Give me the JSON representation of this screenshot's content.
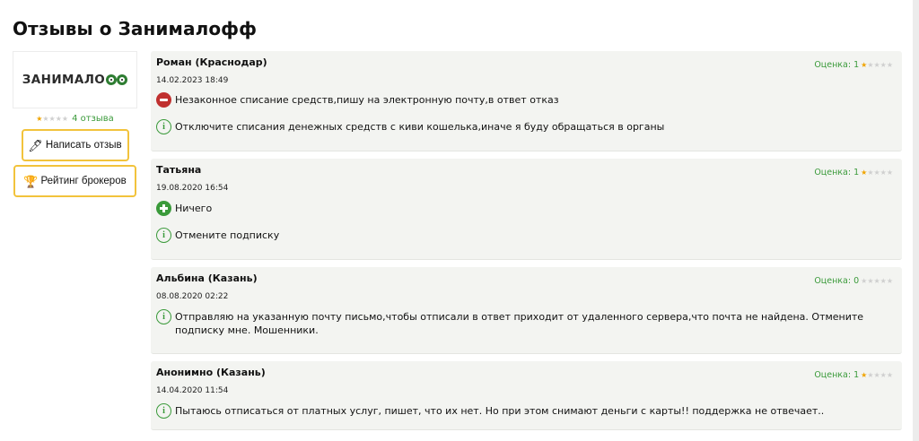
{
  "page": {
    "title": "Отзывы о Занималофф"
  },
  "sidebar": {
    "logo_text": "ЗАНИМАЛО",
    "rating_count": "4 отзыва",
    "rating_stars": 1,
    "write_review": {
      "label": "Написать отзыв",
      "icon": "pen-icon"
    },
    "brokers_rating": {
      "label": "Рейтинг брокеров",
      "icon": "trophy-icon"
    }
  },
  "reviews": [
    {
      "author": "Роман (Краснодар)",
      "date": "14.02.2023 18:49",
      "score_label": "Оценка: 1",
      "stars": 1,
      "lines": [
        {
          "type": "minus",
          "text": "Незаконное списание средств,пишу на электронную почту,в ответ отказ"
        },
        {
          "type": "info",
          "text": "Отключите списания денежных средств с киви кошелька,иначе я буду обращаться в органы"
        }
      ]
    },
    {
      "author": "Татьяна",
      "date": "19.08.2020 16:54",
      "score_label": "Оценка: 1",
      "stars": 1,
      "lines": [
        {
          "type": "plus",
          "text": "Ничего"
        },
        {
          "type": "info",
          "text": "Отмените подписку"
        }
      ]
    },
    {
      "author": "Альбина (Казань)",
      "date": "08.08.2020 02:22",
      "score_label": "Оценка: 0",
      "stars": 0,
      "lines": [
        {
          "type": "info",
          "text": "Отправляю на указанную почту письмо,чтобы отписали в ответ приходит от удаленного сервера,что почта не найдена. Отмените подписку мне. Мошенники."
        }
      ]
    },
    {
      "author": "Анонимно (Казань)",
      "date": "14.04.2020 11:54",
      "score_label": "Оценка: 1",
      "stars": 1,
      "lines": [
        {
          "type": "info",
          "text": "Пытаюсь отписаться от платных услуг, пишет, что их нет. Но при этом снимают деньги с карты!! поддержка не отвечает.."
        }
      ]
    }
  ],
  "colors": {
    "accent_green": "#3a9a3a",
    "star": "#f0a400",
    "button_border": "#f2c33c",
    "minus_red": "#c0302f",
    "card_bg": "#f3f4f1"
  }
}
